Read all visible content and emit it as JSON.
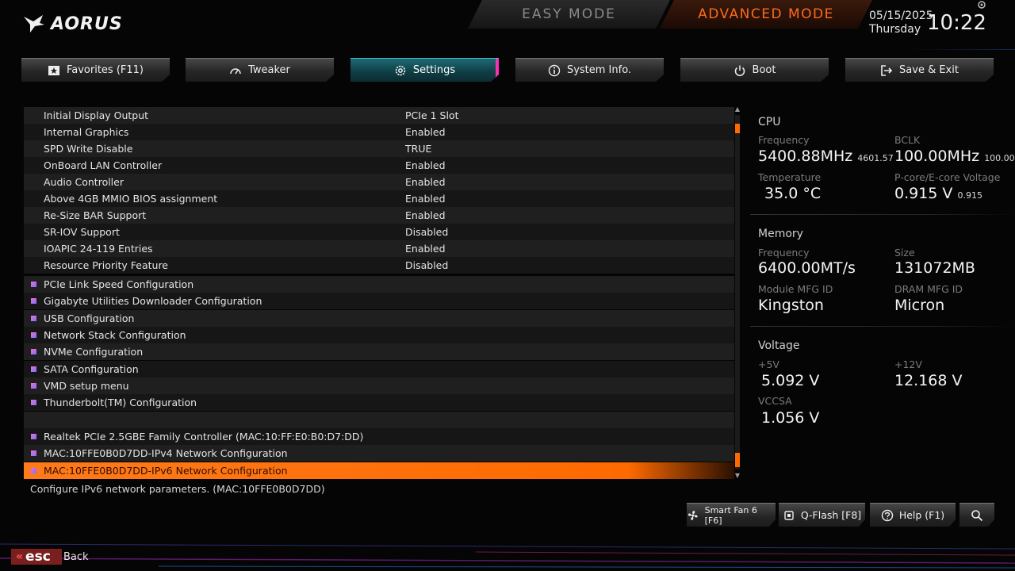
{
  "header": {
    "brand": "AORUS",
    "easy_mode": "EASY MODE",
    "advanced_mode": "ADVANCED MODE",
    "date": "05/15/2025",
    "weekday": "Thursday",
    "time": "10:22"
  },
  "tabs": [
    {
      "label": "Favorites (F11)",
      "icon": "star-icon"
    },
    {
      "label": "Tweaker",
      "icon": "gauge-icon"
    },
    {
      "label": "Settings",
      "icon": "gear-icon",
      "active": true
    },
    {
      "label": "System Info.",
      "icon": "info-icon"
    },
    {
      "label": "Boot",
      "icon": "power-icon"
    },
    {
      "label": "Save & Exit",
      "icon": "exit-icon"
    }
  ],
  "settings": [
    {
      "label": "Initial Display Output",
      "value": "PCIe 1 Slot"
    },
    {
      "label": "Internal Graphics",
      "value": "Enabled"
    },
    {
      "label": "SPD Write Disable",
      "value": "TRUE"
    },
    {
      "label": "OnBoard LAN Controller",
      "value": "Enabled"
    },
    {
      "label": "Audio Controller",
      "value": "Enabled"
    },
    {
      "label": "Above 4GB MMIO BIOS assignment",
      "value": "Enabled"
    },
    {
      "label": "Re-Size BAR Support",
      "value": "Enabled"
    },
    {
      "label": "SR-IOV Support",
      "value": "Disabled"
    },
    {
      "label": "IOAPIC 24-119 Entries",
      "value": "Enabled"
    },
    {
      "label": "Resource Priority Feature",
      "value": "Disabled"
    }
  ],
  "submenus": [
    "PCIe Link Speed Configuration",
    "Gigabyte Utilities Downloader Configuration",
    "USB Configuration",
    "Network Stack Configuration",
    "NVMe Configuration",
    "SATA Configuration",
    "VMD setup menu",
    "Thunderbolt(TM) Configuration"
  ],
  "network_items": [
    "Realtek PCIe 2.5GBE Family Controller (MAC:10:FF:E0:B0:D7:DD)",
    "MAC:10FFE0B0D7DD-IPv4 Network Configuration",
    "MAC:10FFE0B0D7DD-IPv6 Network Configuration"
  ],
  "help_text": "Configure IPv6 network parameters. (MAC:10FFE0B0D7DD)",
  "cpu": {
    "title": "CPU",
    "freq_label": "Frequency",
    "freq_value": "5400.88MHz",
    "freq_sub": "4601.57",
    "bclk_label": "BCLK",
    "bclk_value": "100.00MHz",
    "bclk_sub": "100.00",
    "temp_label": "Temperature",
    "temp_value": "35.0 °C",
    "volt_label": "P-core/E-core Voltage",
    "volt_value": "0.915 V",
    "volt_sub": "0.915"
  },
  "memory": {
    "title": "Memory",
    "freq_label": "Frequency",
    "freq_value": "6400.00MT/s",
    "size_label": "Size",
    "size_value": "131072MB",
    "module_label": "Module MFG ID",
    "module_value": "Kingston",
    "dram_label": "DRAM MFG ID",
    "dram_value": "Micron"
  },
  "voltage": {
    "title": "Voltage",
    "v5_label": "+5V",
    "v5_value": "5.092 V",
    "v12_label": "+12V",
    "v12_value": "12.168 V",
    "vccsa_label": "VCCSA",
    "vccsa_value": "1.056 V"
  },
  "footer": {
    "smart_fan": "Smart Fan 6 [F6]",
    "qflash": "Q-Flash [F8]",
    "help": "Help (F1)",
    "esc": "esc",
    "back": "Back"
  },
  "colors": {
    "accent_orange": "#ff6a00",
    "accent_teal": "#1d6a72",
    "accent_pink": "#ff2fb5"
  }
}
